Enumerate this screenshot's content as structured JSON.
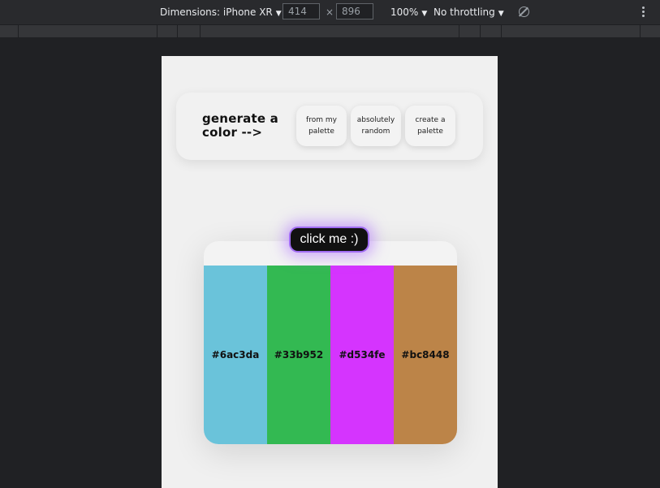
{
  "devtools": {
    "dimensions_label": "Dimensions: iPhone XR",
    "width": "414",
    "height": "896",
    "times": "×",
    "zoom": "100%",
    "throttling": "No throttling"
  },
  "app": {
    "generate_title": "generate a color -->",
    "options": [
      {
        "label": "from my palette"
      },
      {
        "label": "absolutely random"
      },
      {
        "label": "create a palette"
      }
    ],
    "click_button": "click me :)",
    "swatches": [
      {
        "hex": "#6ac3da",
        "color": "#6ac3da"
      },
      {
        "hex": "#33b952",
        "color": "#33b952"
      },
      {
        "hex": "#d534fe",
        "color": "#d534fe"
      },
      {
        "hex": "#bc8448",
        "color": "#bc8448"
      }
    ]
  }
}
